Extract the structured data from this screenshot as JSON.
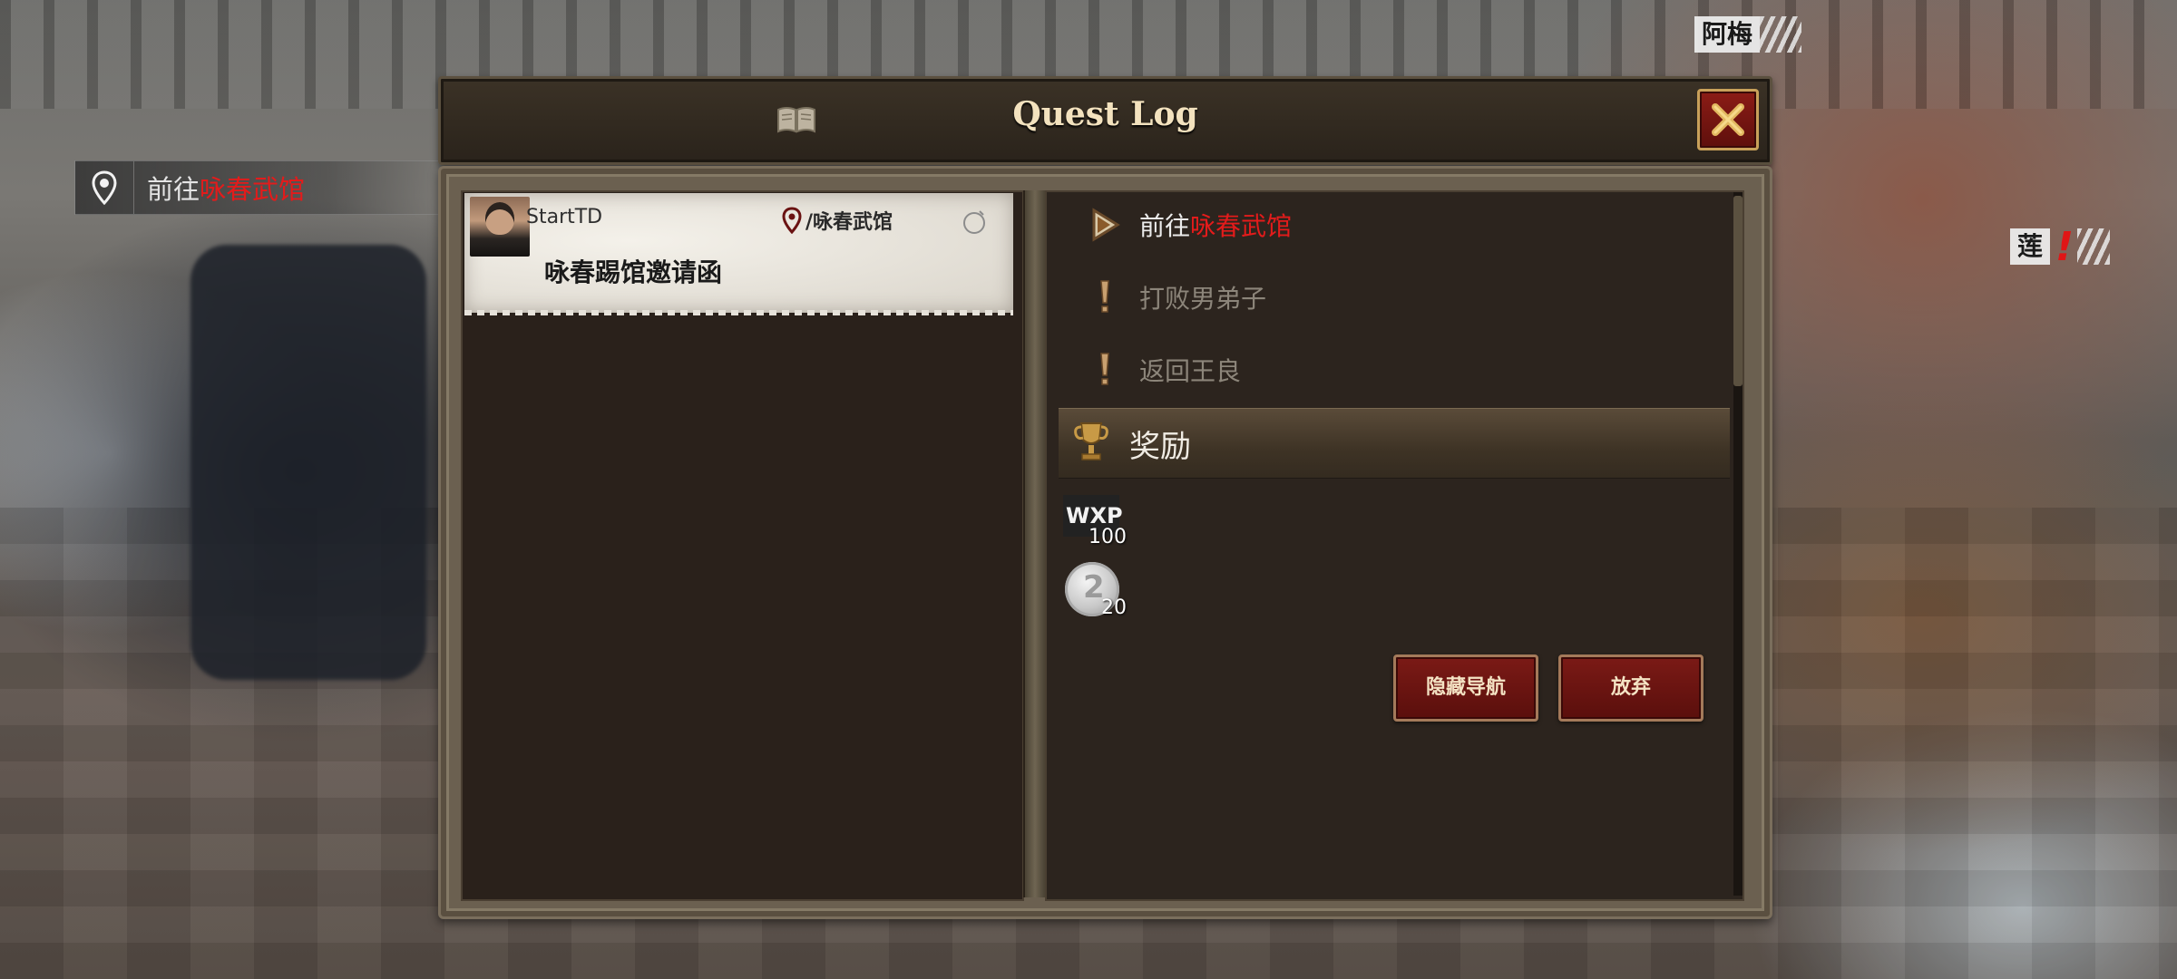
{
  "hud": {
    "nav_prefix": "前往",
    "nav_target": "咏春武馆",
    "npc_top": "阿梅",
    "npc_right": "莲",
    "npc_right_marker": "!"
  },
  "window": {
    "title": "Quest Log",
    "close_icon": "close-x-icon",
    "book_icon": "book-icon"
  },
  "quest_list": [
    {
      "giver": "StartTD",
      "location": "/咏春武馆",
      "title": "咏春踢馆邀请函"
    }
  ],
  "objectives": [
    {
      "prefix": "前往",
      "target": "咏春武馆",
      "state": "active"
    },
    {
      "text": "打败男弟子",
      "state": "pending"
    },
    {
      "text": "返回王良",
      "state": "pending"
    }
  ],
  "rewards": {
    "header": "奖励",
    "items": [
      {
        "label": "WXP",
        "amount": "100"
      },
      {
        "icon": "silver-coin-icon",
        "amount": "20"
      }
    ]
  },
  "buttons": {
    "hide_nav": "隐藏导航",
    "abandon": "放弃"
  },
  "colors": {
    "highlight_red": "#e31b1b",
    "button_red": "#7b1a16",
    "panel_dark": "#2c241e"
  }
}
